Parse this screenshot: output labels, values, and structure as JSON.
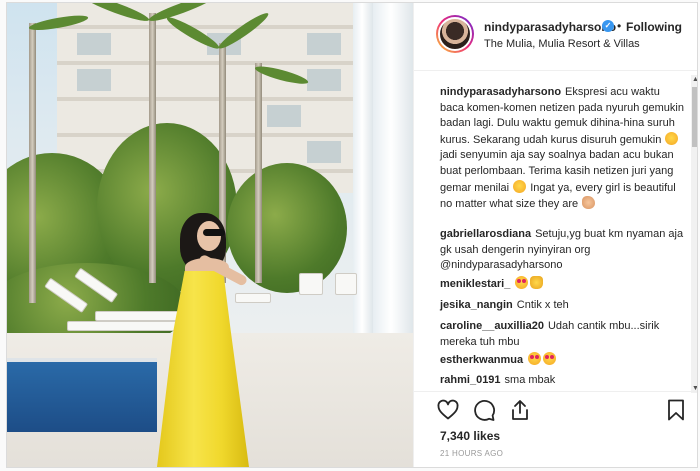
{
  "post": {
    "username": "nindyparasadyharsono",
    "follow_state": "Following",
    "separator": "•",
    "location": "The Mulia, Mulia Resort & Villas",
    "likes": "7,340 likes",
    "timestamp": "21 HOURS AGO"
  },
  "caption": {
    "username": "nindyparasadyharsono",
    "text_1": "Ekspresi acu waktu baca komen-komen netizen pada nyuruh gemukin badan lagi. Dulu waktu gemuk dihina-hina suruh kurus. Sekarang udah kurus disuruh gemukin",
    "text_2": "jadi senyumin aja say soalnya badan acu bukan buat perlombaan. Terima kasih netizen juri yang gemar menilai",
    "text_3": "Ingat ya, every girl is beautiful no matter what size they are"
  },
  "comments": [
    {
      "user": "gabriellarosdiana",
      "text": "Setuju,yg buat km nyaman aja gk usah dengerin nyinyiran org @nindyparasadyharsono"
    },
    {
      "user": "meniklestari_",
      "text": ""
    },
    {
      "user": "jesika_nangin",
      "text": "Cntik x teh"
    },
    {
      "user": "caroline__auxillia20",
      "text": "Udah cantik mbu...sirik mereka tuh mbu"
    },
    {
      "user": "estherkwanmua",
      "text": ""
    },
    {
      "user": "rahmi_0191",
      "text": "sma mbak"
    }
  ],
  "icons": {
    "like": "heart-icon",
    "comment": "comment-icon",
    "share": "share-icon",
    "save": "bookmark-icon",
    "verified": "verified-badge-icon"
  },
  "colors": {
    "verified": "#3897f0",
    "dress": "#f2dc34",
    "pool": "#2a6aa8"
  }
}
